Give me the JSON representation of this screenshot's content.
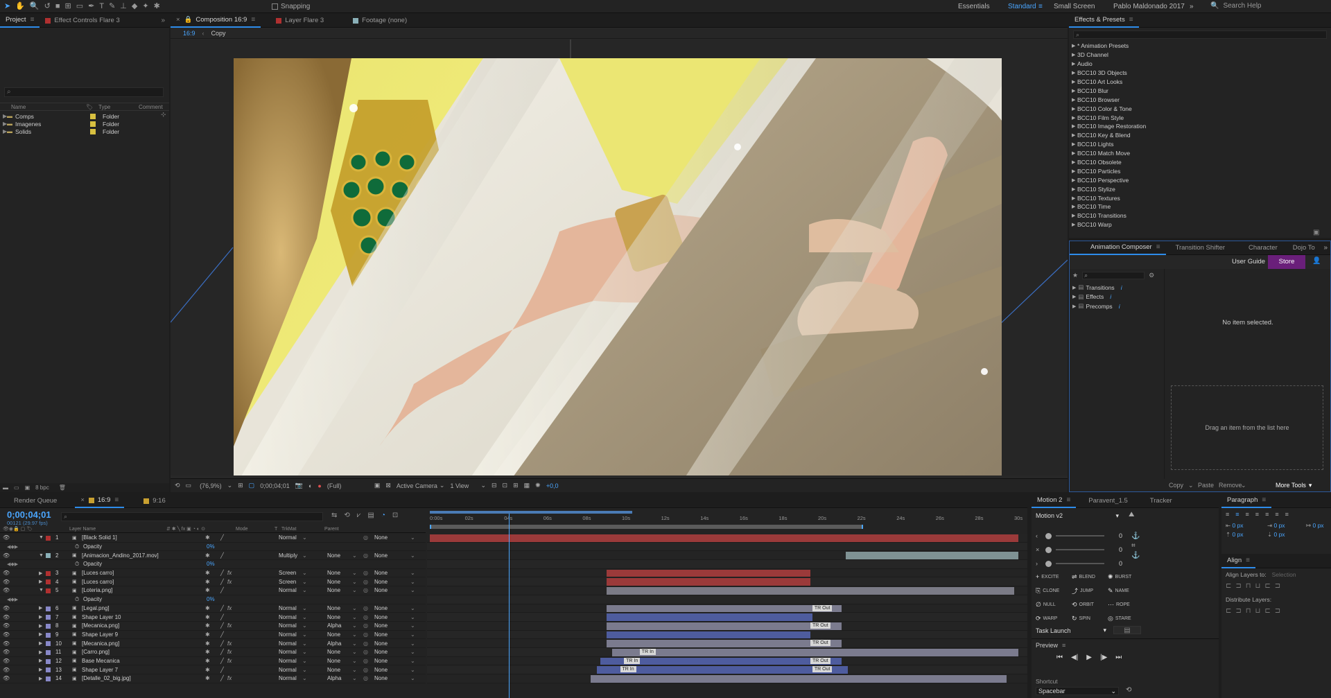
{
  "toolbar": {
    "snapping_label": "Snapping",
    "workspaces": [
      "Essentials",
      "Standard",
      "Small Screen",
      "Pablo Maldonado 2017"
    ],
    "active_workspace": "Standard",
    "search_help": "Search Help"
  },
  "project": {
    "tabs": [
      "Project",
      "Effect Controls Flare 3"
    ],
    "columns": [
      "Name",
      "Type",
      "Comment"
    ],
    "items": [
      {
        "name": "Comps",
        "type": "Folder"
      },
      {
        "name": "Imagenes",
        "type": "Folder"
      },
      {
        "name": "Solids",
        "type": "Folder"
      }
    ],
    "bpc": "8 bpc"
  },
  "viewer": {
    "tabs": [
      "Composition 16:9",
      "Layer Flare 3",
      "Footage (none)"
    ],
    "breadcrumb": [
      "16:9",
      "Copy"
    ],
    "zoom": "(76,9%)",
    "timecode": "0;00;04;01",
    "resolution": "(Full)",
    "camera": "Active Camera",
    "views": "1 View",
    "exposure": "+0,0"
  },
  "effects_presets": {
    "title": "Effects & Presets",
    "items": [
      "* Animation Presets",
      "3D Channel",
      "Audio",
      "BCC10 3D Objects",
      "BCC10 Art Looks",
      "BCC10 Blur",
      "BCC10 Browser",
      "BCC10 Color & Tone",
      "BCC10 Film Style",
      "BCC10 Image Restoration",
      "BCC10 Key & Blend",
      "BCC10 Lights",
      "BCC10 Match Move",
      "BCC10 Obsolete",
      "BCC10 Particles",
      "BCC10 Perspective",
      "BCC10 Stylize",
      "BCC10 Textures",
      "BCC10 Time",
      "BCC10 Transitions",
      "BCC10 Warp"
    ]
  },
  "animation_composer": {
    "tabs": [
      "Animation Composer",
      "Transition Shifter",
      "Character",
      "Dojo To"
    ],
    "user_guide": "User Guide",
    "store": "Store",
    "tree": [
      "Transitions",
      "Effects",
      "Precomps"
    ],
    "no_item": "No item selected.",
    "drag_hint": "Drag an item from the list here",
    "footer": [
      "Copy",
      "Paste",
      "Remove",
      "More Tools"
    ]
  },
  "timeline": {
    "tabs": [
      "Render Queue",
      "16:9",
      "9:16"
    ],
    "timecode": "0;00;04;01",
    "frame_info": "00121 (29.97 fps)",
    "columns": [
      "Layer Name",
      "Mode",
      "T",
      "TrkMat",
      "Parent"
    ],
    "ruler": [
      "0:00s",
      "02s",
      "04s",
      "06s",
      "08s",
      "10s",
      "12s",
      "14s",
      "16s",
      "18s",
      "20s",
      "22s",
      "24s",
      "26s",
      "28s",
      "30s"
    ],
    "layers": [
      {
        "num": "1",
        "name": "[Black Solid 1]",
        "color": "#b03030",
        "mode": "Normal",
        "trk": "",
        "parent": "None",
        "open": true,
        "fx": false
      },
      {
        "num": "",
        "name": "Opacity",
        "prop": true,
        "value": "0%"
      },
      {
        "num": "2",
        "name": "[Animacion_Andino_2017.mov]",
        "color": "#8ab0b8",
        "mode": "Multiply",
        "trk": "None",
        "parent": "None",
        "open": true,
        "fx": false
      },
      {
        "num": "",
        "name": "Opacity",
        "prop": true,
        "value": "0%"
      },
      {
        "num": "3",
        "name": "[Luces carro]",
        "color": "#b03030",
        "mode": "Screen",
        "trk": "None",
        "parent": "None",
        "fx": true
      },
      {
        "num": "4",
        "name": "[Luces carro]",
        "color": "#b03030",
        "mode": "Screen",
        "trk": "None",
        "parent": "None",
        "fx": true
      },
      {
        "num": "5",
        "name": "[Loteria.png]",
        "color": "#b03030",
        "mode": "Normal",
        "trk": "None",
        "parent": "None",
        "open": true,
        "fx": false
      },
      {
        "num": "",
        "name": "Opacity",
        "prop": true,
        "value": "0%"
      },
      {
        "num": "6",
        "name": "[Legal.png]",
        "color": "#8888c8",
        "mode": "Normal",
        "trk": "None",
        "parent": "None",
        "fx": true
      },
      {
        "num": "7",
        "name": "Shape Layer 10",
        "color": "#8888c8",
        "mode": "Normal",
        "trk": "None",
        "parent": "None",
        "fx": false
      },
      {
        "num": "8",
        "name": "[Mecanica.png]",
        "color": "#8888c8",
        "mode": "Normal",
        "trk": "Alpha",
        "parent": "None",
        "fx": true
      },
      {
        "num": "9",
        "name": "Shape Layer 9",
        "color": "#8888c8",
        "mode": "Normal",
        "trk": "None",
        "parent": "None",
        "fx": false
      },
      {
        "num": "10",
        "name": "[Mecanica.png]",
        "color": "#8888c8",
        "mode": "Normal",
        "trk": "Alpha",
        "parent": "None",
        "fx": true
      },
      {
        "num": "11",
        "name": "[Carro.png]",
        "color": "#8888c8",
        "mode": "Normal",
        "trk": "None",
        "parent": "None",
        "fx": true
      },
      {
        "num": "12",
        "name": "Base Mecanica",
        "color": "#8888c8",
        "mode": "Normal",
        "trk": "None",
        "parent": "None",
        "fx": true
      },
      {
        "num": "13",
        "name": "Shape Layer 7",
        "color": "#8888c8",
        "mode": "Normal",
        "trk": "None",
        "parent": "None",
        "fx": false
      },
      {
        "num": "14",
        "name": "[Detalle_02_big.jpg]",
        "color": "#8888c8",
        "mode": "Normal",
        "trk": "Alpha",
        "parent": "None",
        "fx": true
      }
    ],
    "bars": [
      {
        "start": 0.0,
        "end": 30.0,
        "color": "#9b3a3a"
      },
      null,
      {
        "start": 21.2,
        "end": 30.0,
        "color": "#7f9294"
      },
      null,
      {
        "start": 9.0,
        "end": 19.4,
        "color": "#9b3a3a"
      },
      {
        "start": 9.0,
        "end": 19.4,
        "color": "#9b3a3a"
      },
      {
        "start": 9.0,
        "end": 29.8,
        "color": "#7b7b86"
      },
      null,
      {
        "start": 9.0,
        "end": 21.0,
        "color": "#7b7b8e",
        "label": "TR Out",
        "label_at": 19.5
      },
      {
        "start": 9.0,
        "end": 19.5,
        "color": "#4e5c9e"
      },
      {
        "start": 9.0,
        "end": 21.0,
        "color": "#7b7b8e",
        "label": "TR Out",
        "label_at": 19.4
      },
      {
        "start": 9.0,
        "end": 19.4,
        "color": "#4e5c9e"
      },
      {
        "start": 9.0,
        "end": 21.0,
        "color": "#7b7b8e",
        "label": "TR Out",
        "label_at": 19.4
      },
      {
        "start": 9.3,
        "end": 30.0,
        "color": "#7b7b8e",
        "label": "TR In",
        "label_at": 10.7
      },
      {
        "start": 8.7,
        "end": 21.0,
        "color": "#4e5c9e",
        "label": "TR In",
        "label_at": 9.9,
        "label2": "TR Out",
        "label2_at": 19.4
      },
      {
        "start": 8.5,
        "end": 21.3,
        "color": "#4e5c9e",
        "label": "TR In",
        "label_at": 9.7,
        "label2": "TR Out",
        "label2_at": 19.5
      },
      {
        "start": 8.2,
        "end": 29.4,
        "color": "#7b7b8e"
      }
    ],
    "playhead_seconds": 4.03
  },
  "motion": {
    "tabs": [
      "Motion 2",
      "Paravent_1.5",
      "Tracker"
    ],
    "preset": "Motion v2",
    "slider_values": [
      "0",
      "0",
      "0"
    ],
    "buttons": [
      "EXCITE",
      "BLEND",
      "BURST",
      "CLONE",
      "JUMP",
      "NAME",
      "NULL",
      "ORBIT",
      "ROPE",
      "WARP",
      "SPIN",
      "STARE"
    ],
    "task_launch": "Task Launch",
    "preview_title": "Preview",
    "shortcut_label": "Shortcut",
    "shortcut_value": "Spacebar"
  },
  "paragraph": {
    "title": "Paragraph",
    "values": [
      "0 px",
      "0 px",
      "0 px",
      "0 px",
      "0 px"
    ]
  },
  "align": {
    "title": "Align",
    "align_to_label": "Align Layers to:",
    "align_to_value": "Selection",
    "distribute": "Distribute Layers:"
  }
}
